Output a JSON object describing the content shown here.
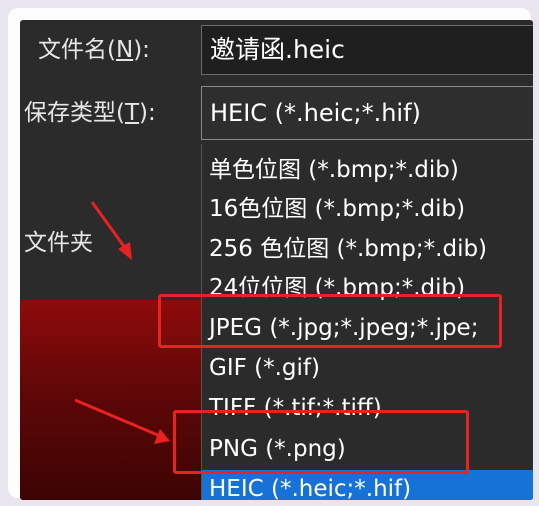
{
  "dialog": {
    "filename_label": "文件名(",
    "filename_key": "N",
    "filename_label_end": "):",
    "filename_value": "邀请函.heic",
    "type_label": "保存类型(",
    "type_key": "T",
    "type_label_end": "):",
    "type_value": "HEIC (*.heic;*.hif)",
    "folder_label": "文件夹"
  },
  "type_options": [
    {
      "label": "单色位图 (*.bmp;*.dib)",
      "selected": false
    },
    {
      "label": "16色位图 (*.bmp;*.dib)",
      "selected": false
    },
    {
      "label": "256 色位图 (*.bmp;*.dib)",
      "selected": false
    },
    {
      "label": "24位位图 (*.bmp;*.dib)",
      "selected": false
    },
    {
      "label": "JPEG (*.jpg;*.jpeg;*.jpe;",
      "selected": false
    },
    {
      "label": "GIF (*.gif)",
      "selected": false
    },
    {
      "label": "TIFF (*.tif;*.tiff)",
      "selected": false
    },
    {
      "label": "PNG (*.png)",
      "selected": false
    },
    {
      "label": "HEIC (*.heic;*.hif)",
      "selected": true
    }
  ],
  "colors": {
    "annotation_red": "#e82222",
    "selection_blue": "#1672d6"
  }
}
